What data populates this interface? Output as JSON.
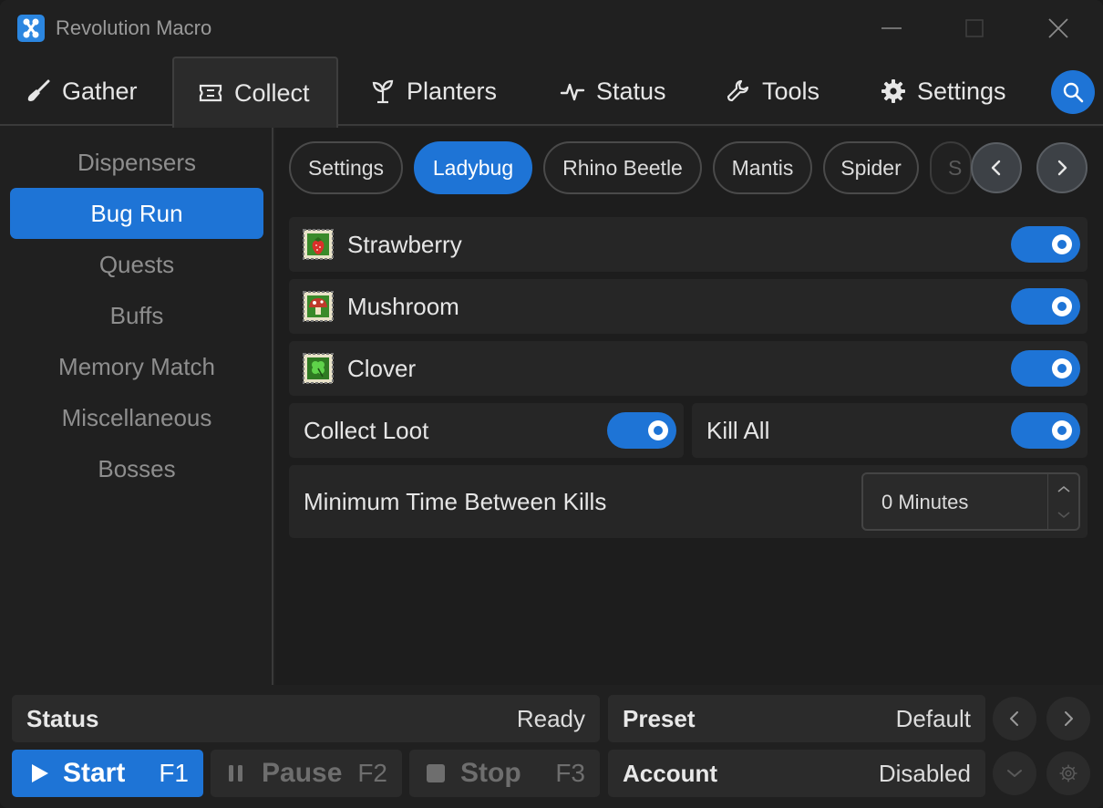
{
  "window": {
    "title": "Revolution Macro",
    "logo_icon": "revolution-logo-icon",
    "accent_color": "#1e74d6"
  },
  "tabs": [
    {
      "label": "Gather",
      "icon": "shovel-icon"
    },
    {
      "label": "Collect",
      "icon": "ticket-icon",
      "active": true
    },
    {
      "label": "Planters",
      "icon": "sprout-icon"
    },
    {
      "label": "Status",
      "icon": "pulse-icon"
    },
    {
      "label": "Tools",
      "icon": "wrench-icon"
    },
    {
      "label": "Settings",
      "icon": "gear-icon"
    }
  ],
  "sidebar": {
    "items": [
      {
        "label": "Dispensers"
      },
      {
        "label": "Bug Run",
        "active": true
      },
      {
        "label": "Quests"
      },
      {
        "label": "Buffs"
      },
      {
        "label": "Memory Match"
      },
      {
        "label": "Miscellaneous"
      },
      {
        "label": "Bosses"
      }
    ]
  },
  "subtabs": [
    {
      "label": "Settings"
    },
    {
      "label": "Ladybug",
      "active": true
    },
    {
      "label": "Rhino Beetle"
    },
    {
      "label": "Mantis"
    },
    {
      "label": "Spider"
    },
    {
      "label": "S"
    }
  ],
  "fields": [
    {
      "label": "Strawberry",
      "icon": "strawberry-stamp-icon",
      "enabled": true
    },
    {
      "label": "Mushroom",
      "icon": "mushroom-stamp-icon",
      "enabled": true
    },
    {
      "label": "Clover",
      "icon": "clover-stamp-icon",
      "enabled": true
    }
  ],
  "options": {
    "collect_loot": {
      "label": "Collect Loot",
      "enabled": true
    },
    "kill_all": {
      "label": "Kill All",
      "enabled": true
    }
  },
  "min_time": {
    "label": "Minimum Time Between Kills",
    "value": "0 Minutes"
  },
  "bottom": {
    "status_label": "Status",
    "status_value": "Ready",
    "preset_label": "Preset",
    "preset_value": "Default",
    "account_label": "Account",
    "account_value": "Disabled",
    "start_label": "Start",
    "start_key": "F1",
    "pause_label": "Pause",
    "pause_key": "F2",
    "stop_label": "Stop",
    "stop_key": "F3"
  }
}
